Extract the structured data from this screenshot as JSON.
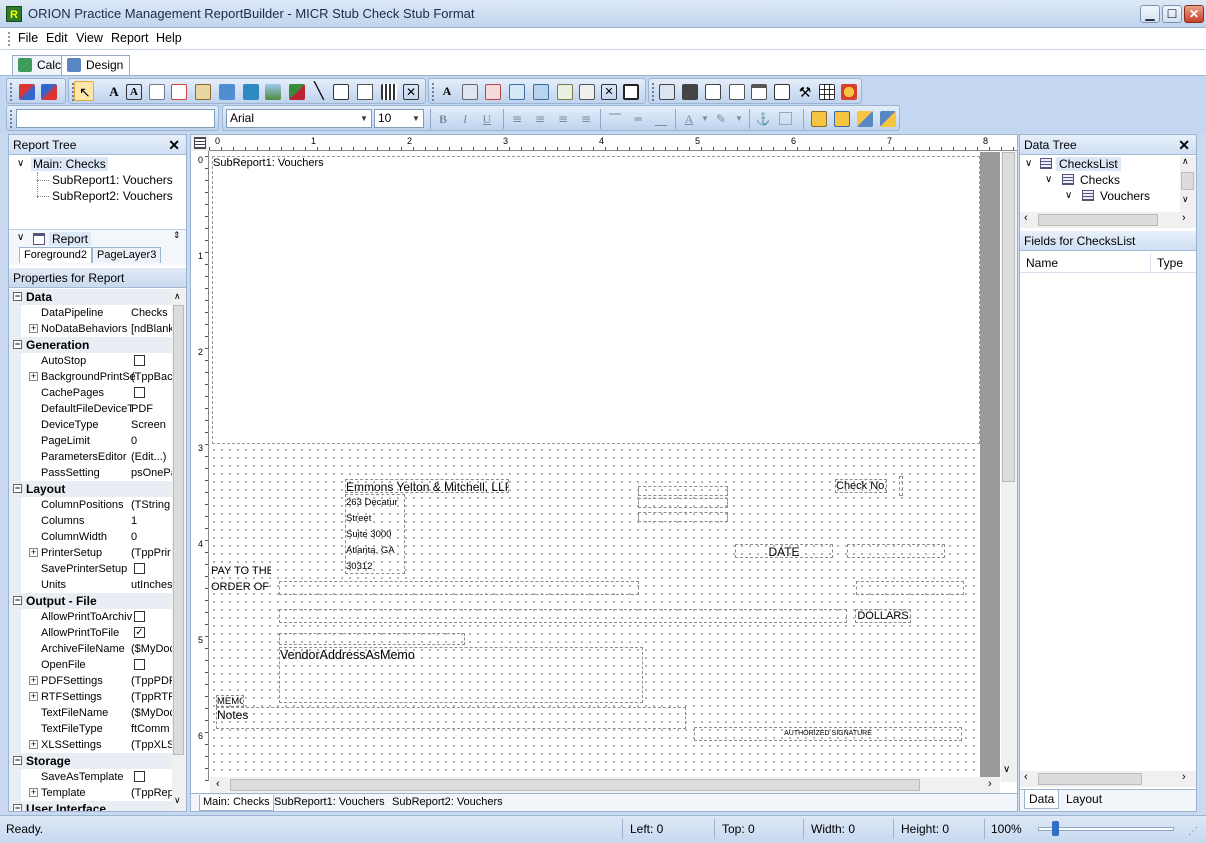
{
  "window": {
    "title": "ORION Practice Management ReportBuilder - MICR Stub Check Stub Format",
    "app_icon_letter": "R",
    "min": "▁",
    "max": "☐",
    "close": "✕"
  },
  "menu": [
    "File",
    "Edit",
    "View",
    "Report",
    "Help"
  ],
  "tabs": [
    "Calc",
    "Design"
  ],
  "toolbar": {
    "font_name": "Arial",
    "font_size": "10",
    "bold": "B",
    "italic": "I",
    "underline": "U"
  },
  "report_tree": {
    "header": "Report Tree",
    "items": [
      "Main: Checks",
      "SubReport1: Vouchers",
      "SubReport2: Vouchers"
    ],
    "layer_selector": "Report",
    "layer_tabs": [
      "Foreground2",
      "PageLayer3"
    ]
  },
  "properties": {
    "header": "Properties for Report",
    "categories": [
      {
        "name": "Data",
        "rows": [
          {
            "name": "DataPipeline",
            "value": "Checks"
          },
          {
            "name": "NoDataBehaviors",
            "value": "[ndBlank",
            "expand": true
          }
        ]
      },
      {
        "name": "Generation",
        "rows": [
          {
            "name": "AutoStop",
            "check": ""
          },
          {
            "name": "BackgroundPrintSe",
            "value": "(TppBac",
            "expand": true
          },
          {
            "name": "CachePages",
            "check": ""
          },
          {
            "name": "DefaultFileDeviceT",
            "value": "PDF"
          },
          {
            "name": "DeviceType",
            "value": "Screen"
          },
          {
            "name": "PageLimit",
            "value": "0"
          },
          {
            "name": "ParametersEditor",
            "value": "(Edit...)"
          },
          {
            "name": "PassSetting",
            "value": "psOnePa"
          }
        ]
      },
      {
        "name": "Layout",
        "rows": [
          {
            "name": "ColumnPositions",
            "value": "(TString"
          },
          {
            "name": "Columns",
            "value": "1"
          },
          {
            "name": "ColumnWidth",
            "value": "0"
          },
          {
            "name": "PrinterSetup",
            "value": "(TppPrir",
            "expand": true
          },
          {
            "name": "SavePrinterSetup",
            "check": ""
          },
          {
            "name": "Units",
            "value": "utInches"
          }
        ]
      },
      {
        "name": "Output - File",
        "rows": [
          {
            "name": "AllowPrintToArchiv",
            "check": ""
          },
          {
            "name": "AllowPrintToFile",
            "check": "✓"
          },
          {
            "name": "ArchiveFileName",
            "value": "($MyDoc"
          },
          {
            "name": "OpenFile",
            "check": ""
          },
          {
            "name": "PDFSettings",
            "value": "(TppPDF",
            "expand": true
          },
          {
            "name": "RTFSettings",
            "value": "(TppRTF",
            "expand": true
          },
          {
            "name": "TextFileName",
            "value": "($MyDoc"
          },
          {
            "name": "TextFileType",
            "value": "ftComm"
          },
          {
            "name": "XLSSettings",
            "value": "(TppXLS",
            "expand": true
          }
        ]
      },
      {
        "name": "Storage",
        "rows": [
          {
            "name": "SaveAsTemplate",
            "check": ""
          },
          {
            "name": "Template",
            "value": "(TppRep",
            "expand": true
          }
        ]
      },
      {
        "name": "User Interface",
        "rows": []
      }
    ]
  },
  "designer": {
    "ruler_h": [
      "0",
      "1",
      "2",
      "3",
      "4",
      "5",
      "6",
      "7",
      "8"
    ],
    "ruler_v": [
      "0",
      "1",
      "2",
      "3",
      "4",
      "5",
      "6"
    ],
    "subreport_label": "SubReport1: Vouchers",
    "company_name": "Emmons Yelton & Mitchell, LLP",
    "address_lines": [
      "263 Decatur",
      "Street",
      "Suite 3000",
      "Atlanta, GA",
      "30312"
    ],
    "check_no": "Check No.",
    "date": "DATE",
    "pay_to_1": "PAY TO THE",
    "pay_to_2": "ORDER OF",
    "dollars": "DOLLARS",
    "vendor_memo": "VendorAddressAsMemo",
    "memo": "MEMO",
    "notes": "Notes",
    "signature": "AUTHORIZED SIGNATURE",
    "bottom_tabs": [
      "Main: Checks",
      "SubReport1: Vouchers",
      "SubReport2: Vouchers"
    ]
  },
  "data_tree": {
    "header": "Data Tree",
    "items": [
      "ChecksList",
      "Checks",
      "Vouchers"
    ],
    "fields_header": "Fields for ChecksList",
    "col_name": "Name",
    "col_type": "Type",
    "tabs": [
      "Data",
      "Layout"
    ]
  },
  "status": {
    "text": "Ready.",
    "left": "Left: 0",
    "top": "Top: 0",
    "width": "Width: 0",
    "height": "Height: 0",
    "zoom": "100%"
  }
}
